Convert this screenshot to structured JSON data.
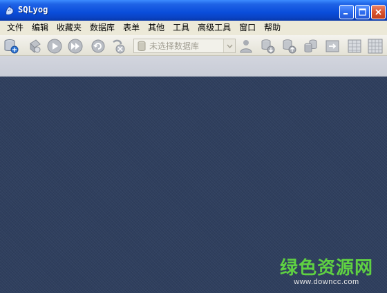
{
  "window": {
    "title": "SQLyog"
  },
  "menu": {
    "items": [
      "文件",
      "编辑",
      "收藏夹",
      "数据库",
      "表单",
      "其他",
      "工具",
      "高级工具",
      "窗口",
      "帮助"
    ]
  },
  "toolbar": {
    "icons": [
      "connect-icon",
      "new-connection-icon",
      "execute-query-icon",
      "execute-all-icon",
      "refresh-icon",
      "stop-icon",
      "user-manager-icon",
      "backup-database-icon",
      "restore-database-icon",
      "copy-database-icon",
      "import-icon",
      "table-data-icon",
      "schema-designer-icon"
    ],
    "database_select": {
      "placeholder": "未选择数据库"
    }
  },
  "watermark": {
    "chinese": "绿色资源网",
    "url": "www.downcc.com"
  },
  "colors": {
    "titlebar": "#0a4ddb",
    "mdi_background": "#2f3f5e",
    "watermark_green": "#5fd142"
  }
}
